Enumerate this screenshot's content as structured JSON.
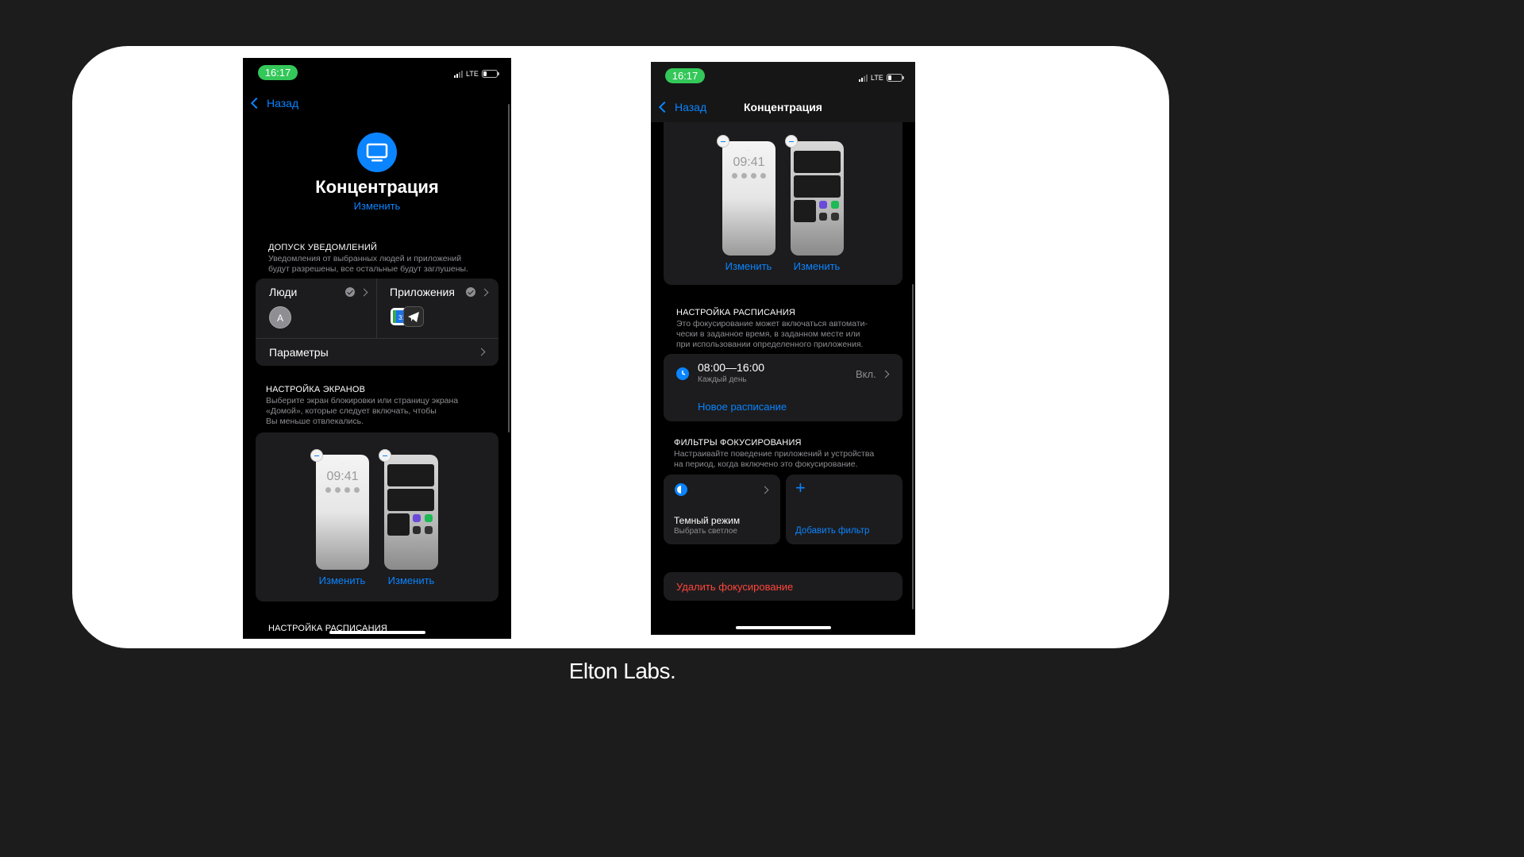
{
  "brand": "Elton Labs.",
  "phone1": {
    "status": {
      "time": "16:17",
      "network": "LTE"
    },
    "back_label": "Назад",
    "focus_icon": "monitor-icon",
    "title": "Концентрация",
    "edit_label": "Изменить",
    "notifications": {
      "title": "ДОПУСК УВЕДОМЛЕНИЙ",
      "description_line1": "Уведомления от выбранных людей и приложений",
      "description_line2": "будут разрешены, все остальные будут заглушены.",
      "people_label": "Люди",
      "people_avatar": "A",
      "apps_label": "Приложения",
      "params_label": "Параметры"
    },
    "screens": {
      "title": "НАСТРОЙКА ЭКРАНОВ",
      "description_line1": "Выберите экран блокировки или страницу экрана",
      "description_line2": "«Домой», которые следует включать, чтобы",
      "description_line3": "Вы меньше отвлекались.",
      "lock_time": "09:41",
      "edit_lock": "Изменить",
      "edit_home": "Изменить"
    },
    "schedule_title": "НАСТРОЙКА РАСПИСАНИЯ"
  },
  "phone2": {
    "status": {
      "time": "16:17",
      "network": "LTE"
    },
    "back_label": "Назад",
    "nav_title": "Концентрация",
    "screens": {
      "lock_time": "09:41",
      "edit_lock": "Изменить",
      "edit_home": "Изменить"
    },
    "schedule": {
      "title": "НАСТРОЙКА РАСПИСАНИЯ",
      "description_line1": "Это фокусирование может включаться автомати-",
      "description_line2": "чески в заданное время, в заданном месте или",
      "description_line3": "при использовании определенного приложения.",
      "time_range": "08:00—16:00",
      "frequency": "Каждый день",
      "state": "Вкл.",
      "new_schedule": "Новое расписание"
    },
    "filters": {
      "title": "ФИЛЬТРЫ ФОКУСИРОВАНИЯ",
      "description_line1": "Настраивайте поведение приложений и устройства",
      "description_line2": "на период, когда включено это фокусирование.",
      "dark_mode_title": "Темный режим",
      "dark_mode_subtitle": "Выбрать светлое",
      "add_filter": "Добавить фильтр"
    },
    "delete_label": "Удалить фокусирование"
  },
  "colors": {
    "accent": "#0a84ff",
    "time_pill": "#34c759",
    "danger": "#ff453a",
    "group_bg": "#1c1c1e"
  }
}
